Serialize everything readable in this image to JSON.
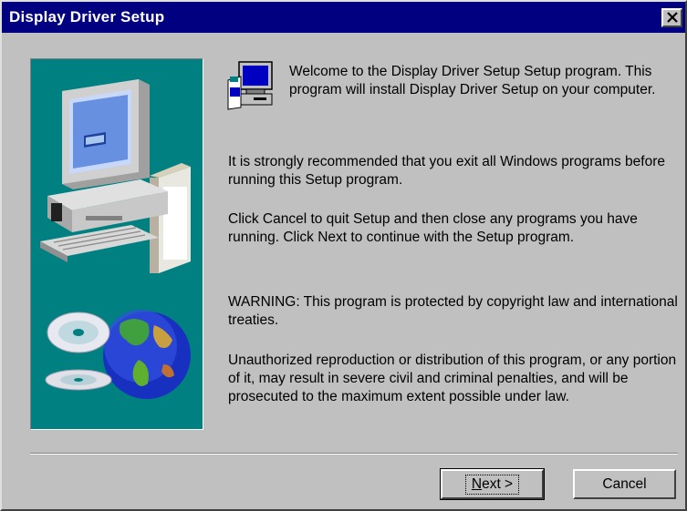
{
  "window": {
    "title": "Display Driver Setup",
    "close_glyph": "✕"
  },
  "icons": {
    "close": "close-icon",
    "setup": "setup-computer-icon",
    "side_art": "computer-globe-cd-illustration"
  },
  "content": {
    "welcome": "Welcome to the Display Driver Setup Setup program.  This program will install Display Driver Setup on your computer.",
    "recommend": "It is strongly recommended that you exit all Windows programs before running this Setup program.",
    "instructions": "Click Cancel to quit Setup and then close any programs you have running.  Click Next to continue with the Setup program.",
    "warning": "WARNING: This program is protected by copyright law and international treaties.",
    "unauthorized": "Unauthorized reproduction or distribution of this program, or any portion of it, may result in severe civil and criminal penalties, and will be prosecuted to the maximum extent possible under law."
  },
  "buttons": {
    "next_mnemonic": "N",
    "next_rest": "ext >",
    "cancel": "Cancel"
  },
  "colors": {
    "titlebar": "#000080",
    "panel": "#008080",
    "face": "#c0c0c0"
  }
}
